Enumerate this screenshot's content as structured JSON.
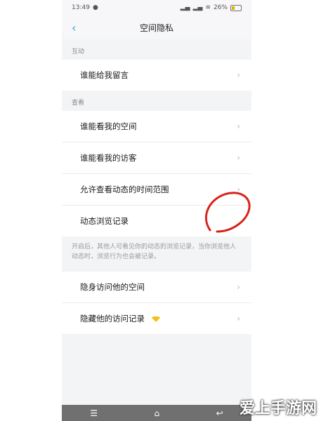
{
  "status_bar": {
    "time": "13:49",
    "battery": "26%",
    "icons": [
      "signal-icon",
      "wifi-icon",
      "battery-icon"
    ]
  },
  "nav": {
    "back_icon": "chevron-left-icon",
    "title": "空间隐私"
  },
  "sections": {
    "interaction_label": "互动",
    "view_label": "查看"
  },
  "rows": {
    "who_can_comment": "谁能给我留言",
    "who_can_view_space": "谁能看我的空间",
    "who_can_view_visitors": "谁能看我的访客",
    "allowed_time_range": "允许查看动态的时间范围",
    "browse_history": "动态浏览记录",
    "invisible_visit": "隐身访问他的空间",
    "hide_visit_record": "隐藏他的访问记录"
  },
  "note": "开启后，其他人可看见你的动态的浏览记录，当你浏览他人动态时，浏览行为也会被记录。",
  "bottom_nav": {
    "menu": "☰",
    "home": "⌂",
    "back": "↩"
  },
  "watermark": "爱上手游网"
}
